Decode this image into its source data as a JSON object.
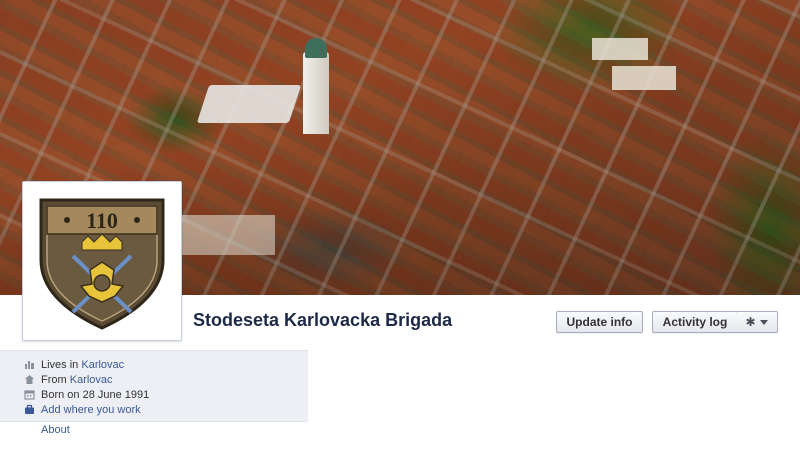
{
  "page": {
    "name": "Stodeseta Karlovacka Brigada"
  },
  "emblem": {
    "number": "110"
  },
  "actions": {
    "update_info": "Update info",
    "activity_log": "Activity log",
    "gear_icon": "gear-icon",
    "menu_icon": "chevron-down-icon"
  },
  "info": {
    "lives_prefix": "Lives in ",
    "lives_city": "Karlovac",
    "from_prefix": "From ",
    "from_city": "Karlovac",
    "born": "Born on 28 June 1991",
    "add_work": "Add where you work",
    "about": "About",
    "icons": [
      "home-icon",
      "house-icon",
      "calendar-icon",
      "briefcase-icon"
    ]
  },
  "colors": {
    "link": "#3b5998",
    "name": "#1c2a47",
    "info_bg": "#edeff4"
  }
}
